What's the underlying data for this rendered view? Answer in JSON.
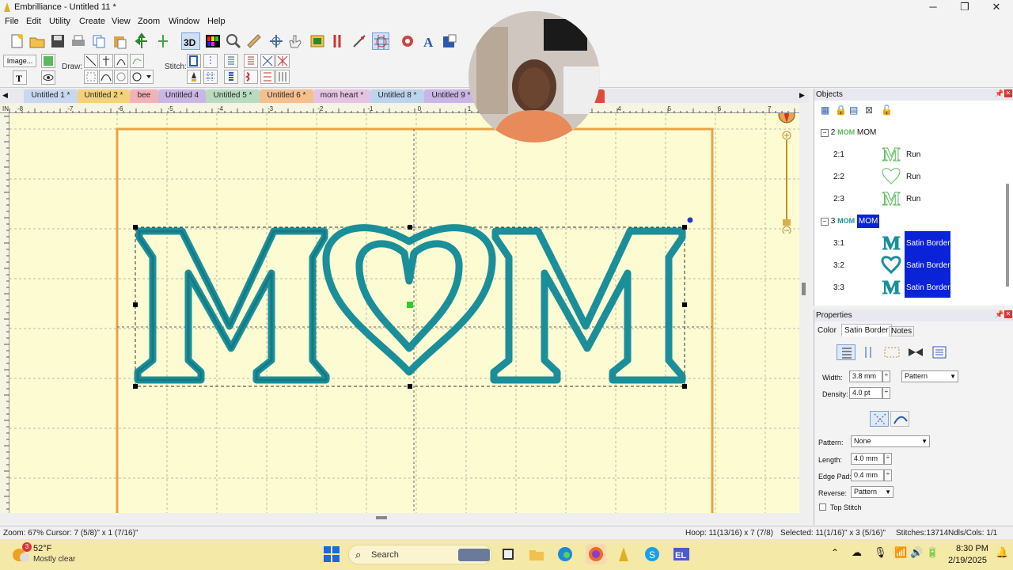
{
  "window": {
    "app_title": "Embrilliance - Untitled 11 *",
    "min": "─",
    "max": "❐",
    "close": "✕"
  },
  "menu": [
    "File",
    "Edit",
    "Utility",
    "Create",
    "View",
    "Zoom",
    "Window",
    "Help"
  ],
  "toolbar2": {
    "image_label": "Image...",
    "draw_label": "Draw:",
    "stitch_label": "Stitch:"
  },
  "tabs": [
    {
      "label": "Untitled 1 *",
      "color": "#c9d8f0"
    },
    {
      "label": "Untitled 2 *",
      "color": "#f5d27a"
    },
    {
      "label": "bee",
      "color": "#f2b3b8"
    },
    {
      "label": "Untitled 4",
      "color": "#c9b6e6"
    },
    {
      "label": "Untitled 5 *",
      "color": "#b9dcc0"
    },
    {
      "label": "Untitled 6 *",
      "color": "#f6c08e"
    },
    {
      "label": "mom heart *",
      "color": "#e7c3e3"
    },
    {
      "label": "Untitled 8 *",
      "color": "#bcd4ec"
    },
    {
      "label": "Untitled 9 *",
      "color": "#c9b6e6"
    }
  ],
  "ruler": {
    "top_marks": [
      "IN",
      "-8",
      "-7",
      "-6",
      "-5",
      "-4",
      "-3",
      "-2",
      "-1",
      "0",
      "1",
      "2",
      "3",
      "4",
      "5",
      "6",
      "7"
    ],
    "compass": "N"
  },
  "design": {
    "text": "MOM",
    "thread_color": "#1a8f9a",
    "hoop_color": "#e8a44a"
  },
  "objects": {
    "header": "Objects",
    "groups": [
      {
        "id": "2",
        "name": "MOM",
        "selected": false,
        "color": "#5bb85b",
        "children": [
          {
            "id": "2:1",
            "name": "Run"
          },
          {
            "id": "2:2",
            "name": "Run"
          },
          {
            "id": "2:3",
            "name": "Run"
          }
        ]
      },
      {
        "id": "3",
        "name": "MOM",
        "selected": true,
        "color": "#1a8f9a",
        "children": [
          {
            "id": "3:1",
            "name": "Satin Border"
          },
          {
            "id": "3:2",
            "name": "Satin Border"
          },
          {
            "id": "3:3",
            "name": "Satin Border"
          }
        ]
      }
    ]
  },
  "properties": {
    "header": "Properties",
    "tabs": [
      "Color",
      "Satin Border",
      "Notes"
    ],
    "width_label": "Width:",
    "width_value": "3.8 mm",
    "width_mode": "Pattern",
    "density_label": "Density:",
    "density_value": "4.0 pt",
    "pattern_label": "Pattern:",
    "pattern_value": "None",
    "length_label": "Length:",
    "length_value": "4.0 mm",
    "edgepad_label": "Edge Pad:",
    "edgepad_value": "0.4 mm",
    "reverse_label": "Reverse:",
    "reverse_value": "Pattern",
    "topstitch_label": "Top Stitch"
  },
  "status": {
    "zoom": "Zoom: 67%  Cursor: 7 (5/8)\" x 1 (7/16)\"",
    "hoop": "Hoop: 11(13/16) x 7 (7/8)",
    "selected": "Selected: 11(1/16)\" x 3 (5/16)\"",
    "stitches": "Stitches:13714",
    "ndls": "Ndls/Cols: 1/1"
  },
  "taskbar": {
    "weather_temp": "52°F",
    "weather_desc": "Mostly clear",
    "weather_badge": "3",
    "search": "Search",
    "time": "8:30 PM",
    "date": "2/19/2025"
  }
}
